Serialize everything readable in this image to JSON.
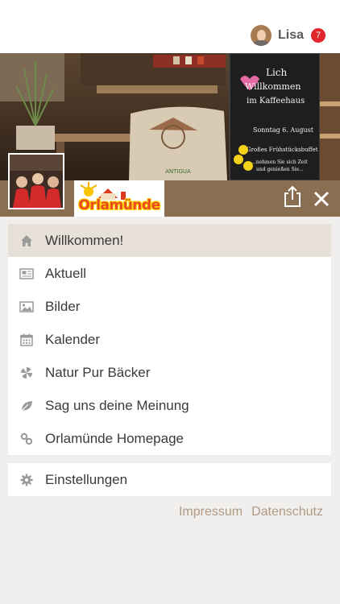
{
  "header": {
    "username": "Lisa",
    "notification_count": "7"
  },
  "brand": {
    "logo_text": "Orlamünde",
    "accent": "#8a6e52",
    "badge_color": "#e1262c",
    "link_color": "#b19983"
  },
  "banner": {
    "sign_line1": "Lich",
    "sign_line2": "Willkommen",
    "sign_line3": "im Kaffeehaus",
    "sign_line4": "Sonntag 6. August",
    "sign_line5": "Großes Frühstücksbuffet",
    "sign_line6": "...nehmen Sie sich Zeit",
    "sign_line7": "und genießen Sie...",
    "sack_label": "ANTIGUA"
  },
  "menu": {
    "items": [
      {
        "label": "Willkommen!",
        "icon": "home-icon"
      },
      {
        "label": "Aktuell",
        "icon": "newspaper-icon"
      },
      {
        "label": "Bilder",
        "icon": "image-icon"
      },
      {
        "label": "Kalender",
        "icon": "calendar-icon"
      },
      {
        "label": "Natur Pur Bäcker",
        "icon": "pinwheel-icon"
      },
      {
        "label": "Sag uns deine Meinung",
        "icon": "leaf-icon"
      },
      {
        "label": "Orlamünde Homepage",
        "icon": "link-icon"
      }
    ],
    "settings_label": "Einstellungen"
  },
  "footer": {
    "impressum": "Impressum",
    "datenschutz": "Datenschutz"
  }
}
